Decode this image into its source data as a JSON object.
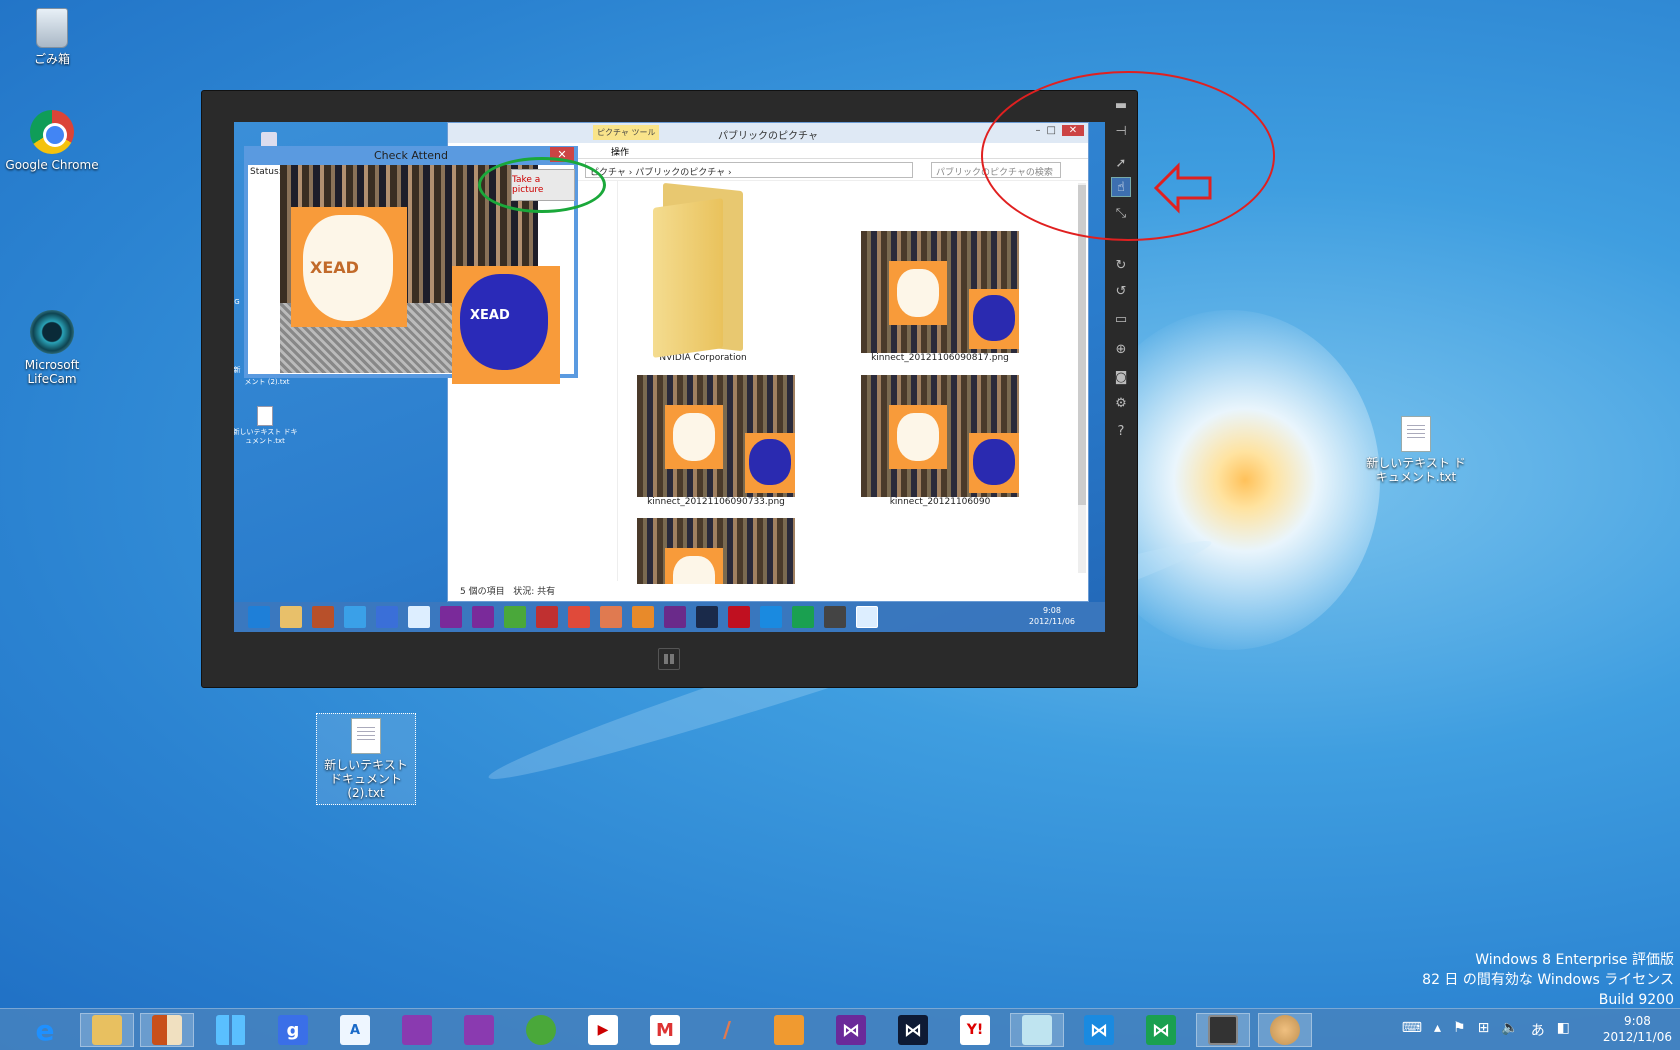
{
  "desktop": {
    "icons": [
      {
        "label": "ごみ箱",
        "icon": "recycle-bin-icon"
      },
      {
        "label": "Google Chrome",
        "icon": "chrome-icon"
      },
      {
        "label": "Microsoft LifeCam",
        "icon": "lifecam-icon"
      },
      {
        "label": "新しいテキスト ドキュメント.txt",
        "icon": "text-file-icon"
      },
      {
        "label": "新しいテキスト ドキュメント (2).txt",
        "icon": "text-file-icon"
      }
    ],
    "watermark": {
      "line1": "Windows 8 Enterprise 評価版",
      "line2": "82 日 の間有効な Windows ライセンス",
      "line3": "Build 9200"
    }
  },
  "taskbar": {
    "apps": [
      "internet-explorer",
      "file-explorer",
      "paint-app",
      "windows-store",
      "google-search",
      "language-bar",
      "visual-studio-purple",
      "visual-studio-purple-2",
      "android-emulator",
      "youtube",
      "gmail",
      "pen-app",
      "paint-brush",
      "visual-studio",
      "visual-studio-dark",
      "yahoo",
      "notepad",
      "visual-studio-blue",
      "visual-studio-green",
      "remote-display",
      "paint-palette"
    ],
    "tray": {
      "ime": "あ"
    },
    "time": "9:08",
    "date": "2012/11/06"
  },
  "simulator": {
    "explorer": {
      "context_tab": "ピクチャ ツール",
      "title": "パブリックのピクチャ",
      "ribbon_tab": "操作",
      "path": "ピクチャ › パブリックのピクチャ ›",
      "search_placeholder": "パブリックのピクチャの検索",
      "items": [
        {
          "name": "NVIDIA Corporation",
          "type": "folder"
        },
        {
          "name": "kinnect_20121106090817.png",
          "type": "image"
        },
        {
          "name": "kinnect_20121106090733.png",
          "type": "image"
        },
        {
          "name": "kinnect_20121106090",
          "type": "image"
        },
        {
          "name": "",
          "type": "image"
        }
      ],
      "status_count": "5 個の項目",
      "status_state": "状況: 共有"
    },
    "check_attend": {
      "title": "Check Attend",
      "status_label": "Status:S",
      "take_picture": "Take a picture",
      "mask_text": "XEAD"
    },
    "inner_desktop": {
      "icon_label": "新しいテキスト ドキュメント.txt",
      "partial_label": "メント (2).txt",
      "partial_G": "G",
      "partial_nn": "新"
    },
    "inner_clock": {
      "time": "9:08",
      "date": "2012/11/06"
    },
    "tools": [
      "minimize",
      "pin",
      "pointer",
      "touch",
      "pinch",
      "rotate-cw",
      "rotate-ccw",
      "display",
      "network",
      "camera",
      "settings",
      "help"
    ]
  },
  "annotations": {
    "green_circle": "#1aa83a",
    "red_circle": "#e02020"
  }
}
